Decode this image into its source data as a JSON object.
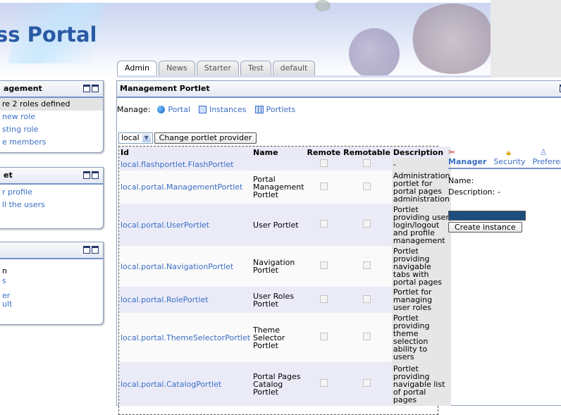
{
  "banner": {
    "logo_text": "ss Portal"
  },
  "tabs": [
    {
      "label": "Admin",
      "active": true
    },
    {
      "label": "News",
      "active": false
    },
    {
      "label": "Starter",
      "active": false
    },
    {
      "label": "Test",
      "active": false
    },
    {
      "label": "default",
      "active": false
    }
  ],
  "sidebar": {
    "portlet1": {
      "title": "agement",
      "items": [
        "re 2 roles defined",
        "new role",
        "sting role",
        "e members"
      ]
    },
    "portlet2": {
      "title": "et",
      "items": [
        "r profile",
        "ll the users"
      ]
    },
    "portlet3": {
      "title": "",
      "items": [
        "n",
        "s",
        "er",
        "ult"
      ]
    }
  },
  "main": {
    "title": "Management Portlet",
    "manage_label": "Manage:",
    "manage_links": [
      "Portal",
      "Instances",
      "Portlets"
    ],
    "provider_value": "local",
    "change_provider_button": "Change portlet provider",
    "columns": [
      "Id",
      "Name",
      "Remote",
      "Remotable",
      "Description"
    ],
    "rows": [
      {
        "id": "local.flashportlet.FlashPortlet",
        "name": "",
        "desc": "-"
      },
      {
        "id": "local.portal.ManagementPortlet",
        "name": "Portal Management Portlet",
        "desc": "Administration portlet for portal pages administration"
      },
      {
        "id": "local.portal.UserPortlet",
        "name": "User Portlet",
        "desc": "Portlet providing user login/logout and profile management"
      },
      {
        "id": "local.portal.NavigationPortlet",
        "name": "Navigation Portlet",
        "desc": "Portlet providing navigable tabs with portal pages"
      },
      {
        "id": "local.portal.RolePortlet",
        "name": "User Roles Portlet",
        "desc": "Portlet for managing user roles"
      },
      {
        "id": "local.portal.ThemeSelectorPortlet",
        "name": "Theme Selector Portlet",
        "desc": "Portlet providing theme selection ability to users"
      },
      {
        "id": "local.portal.CatalogPortlet",
        "name": "Portal Pages Catalog Portlet",
        "desc": "Portlet providing navigable list of portal pages"
      }
    ]
  },
  "right_panel": {
    "tabs": [
      "Manager",
      "Security",
      "Preferenc"
    ],
    "name_label": "Name:",
    "description_label": "Description: -",
    "create_button": "Create instance"
  }
}
